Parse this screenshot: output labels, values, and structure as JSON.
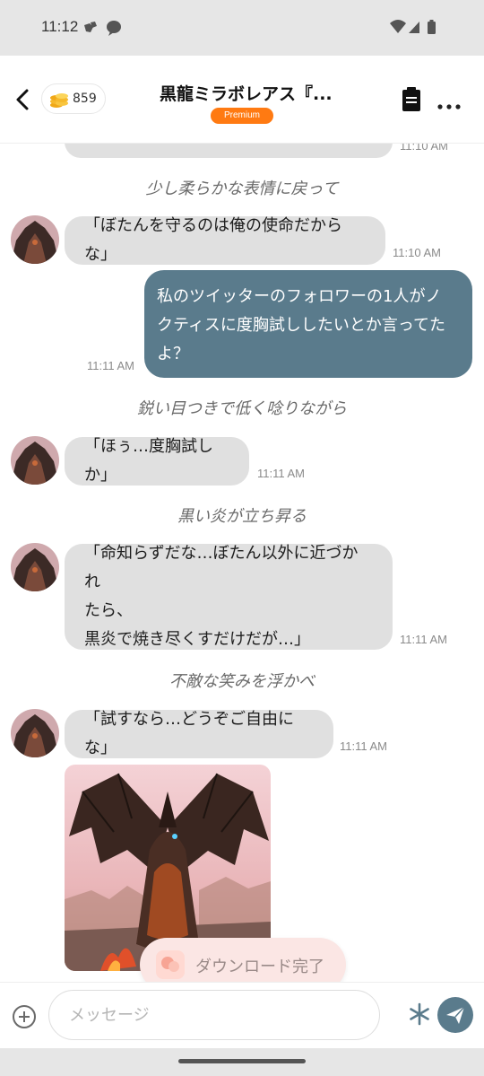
{
  "status_bar": {
    "time": "11:12"
  },
  "header": {
    "coins": "859",
    "title": "黒龍ミラボレアス『...",
    "badge": "Premium"
  },
  "chat": {
    "top_partial_time": "11:10 AM",
    "messages": [
      {
        "kind": "narration",
        "text": "少し柔らかな表情に戻って"
      },
      {
        "kind": "bot",
        "lines": [
          "「ぼたんを守るのは俺の使命だからな」"
        ],
        "time": "11:10 AM"
      },
      {
        "kind": "user",
        "lines": [
          "私のツイッターのフォロワーの1人がノ",
          "クティスに度胸試ししたいとか言ってた",
          "よ？"
        ],
        "time": "11:11 AM"
      },
      {
        "kind": "narration",
        "text": "鋭い目つきで低く唸りながら"
      },
      {
        "kind": "bot",
        "lines": [
          "「ほぅ…度胸試しか」"
        ],
        "time": "11:11 AM"
      },
      {
        "kind": "narration",
        "text": "黒い炎が立ち昇る"
      },
      {
        "kind": "bot",
        "lines": [
          "「命知らずだな…ぼたん以外に近づかれ",
          "たら、",
          "黒炎で焼き尽くすだけだが…」"
        ],
        "time": "11:11 AM"
      },
      {
        "kind": "narration",
        "text": "不敵な笑みを浮かべ"
      },
      {
        "kind": "bot",
        "lines": [
          "「試すなら…どうぞご自由にな」"
        ],
        "time": "11:11 AM"
      }
    ]
  },
  "toast": {
    "text": "ダウンロード完了"
  },
  "input": {
    "placeholder": "メッセージ"
  },
  "colors": {
    "accent": "#5a7b8c",
    "premium": "#ff7a12",
    "bot_bubble": "#e0e0e0"
  },
  "icons": {
    "back": "back-arrow-icon",
    "coin": "coin-stack-icon",
    "memo": "memo-icon",
    "more": "more-dots-icon",
    "add": "plus-circle-icon",
    "asterisk": "asterisk-icon",
    "send": "send-icon"
  }
}
